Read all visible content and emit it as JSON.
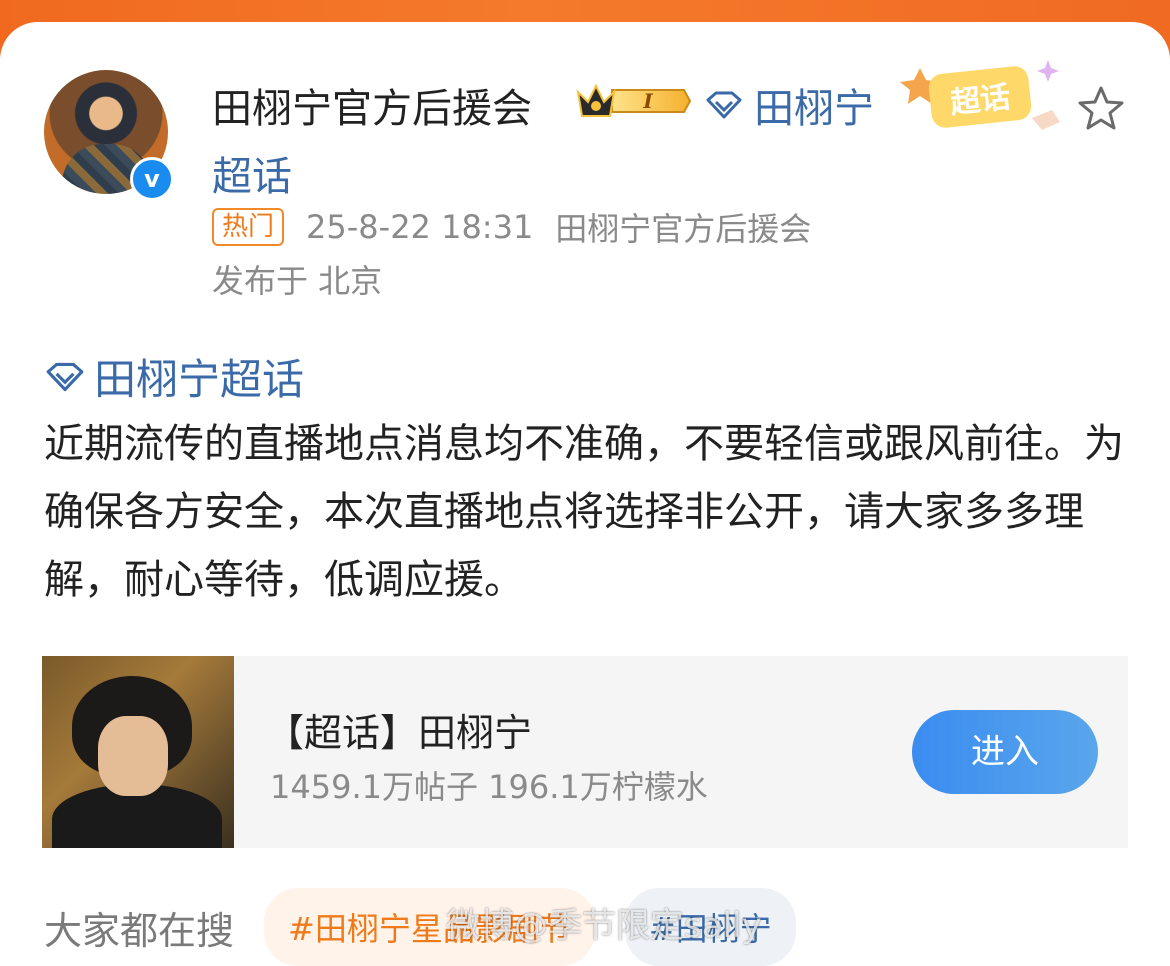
{
  "post": {
    "author_name": "田栩宁官方后援会",
    "vip_level": "I",
    "topic_name": "田栩宁",
    "topic_suffix": "超话",
    "sticker_text": "超话",
    "hot_tag": "热门",
    "timestamp": "25-8-22 18:31",
    "source": "田栩宁官方后援会",
    "location": "发布于 北京",
    "topic_link": "田栩宁超话",
    "content": "近期流传的直播地点消息均不准确，不要轻信或跟风前往。为确保各方安全，本次直播地点将选择非公开，请大家多多理解，耐心等待，低调应援。"
  },
  "supertopic_card": {
    "title": "【超话】田栩宁",
    "stats": "1459.1万帖子 196.1万柠檬水",
    "enter_label": "进入"
  },
  "search": {
    "label": "大家都在搜",
    "tags": [
      "#田栩宁星品影剧节",
      "#田栩宁"
    ]
  },
  "watermark": "微博@季节限定sally",
  "colors": {
    "accent_orange": "#f07a1a",
    "link_blue": "#3b6aa8",
    "verified_blue": "#1a8cf0"
  }
}
